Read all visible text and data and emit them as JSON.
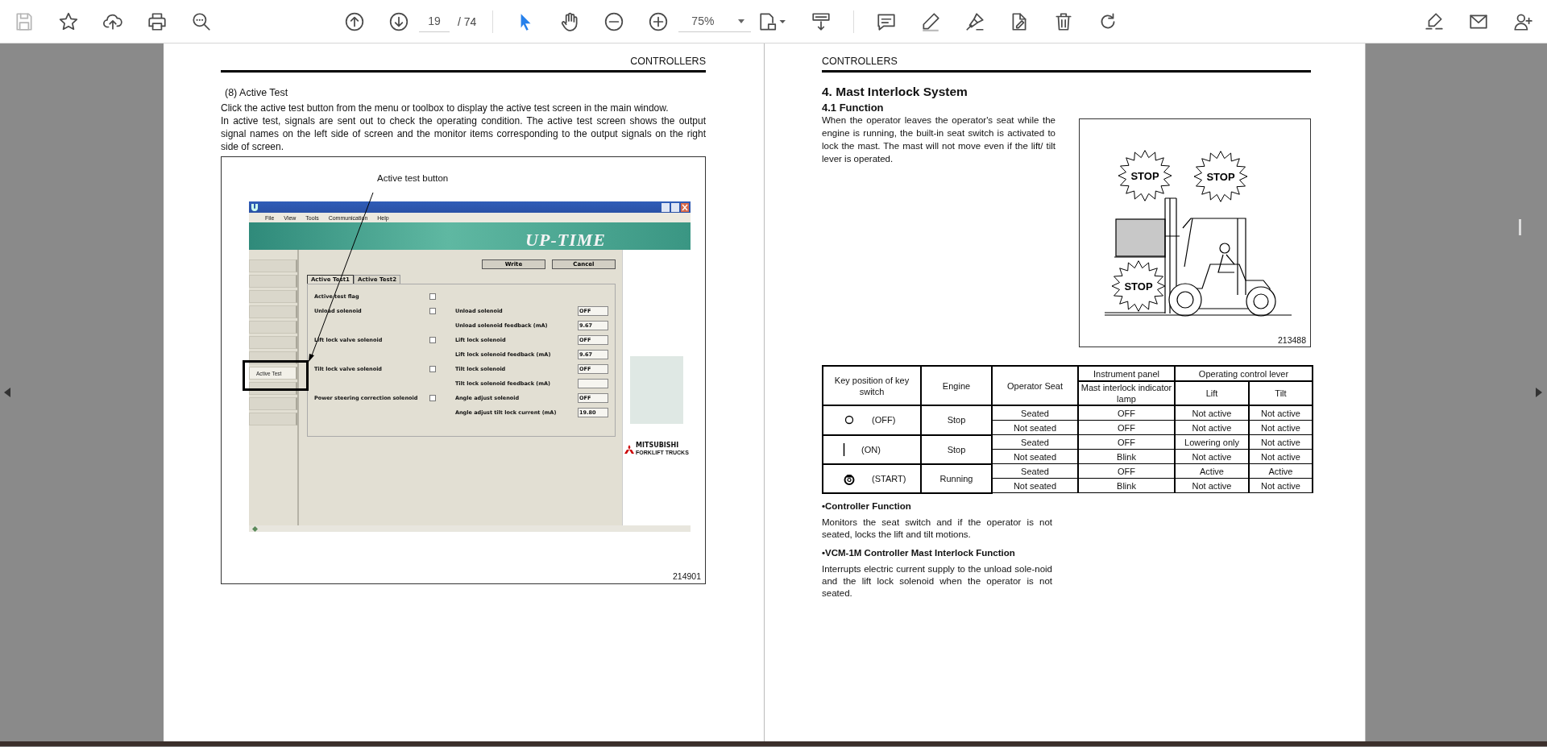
{
  "toolbar": {
    "file_tools": [
      {
        "kind": "save",
        "disabled": true
      },
      {
        "kind": "bookmark",
        "disabled": false
      },
      {
        "kind": "upload",
        "disabled": false
      },
      {
        "kind": "print",
        "disabled": false
      },
      {
        "kind": "find",
        "disabled": false
      }
    ],
    "page_nav": {
      "current": "19",
      "total": "/ 74"
    },
    "modes": [
      {
        "kind": "select",
        "selected": true
      },
      {
        "kind": "hand",
        "selected": false
      }
    ],
    "zoom": {
      "value": "75%"
    },
    "annotate_tools": [
      {
        "kind": "comment"
      },
      {
        "kind": "pencil"
      },
      {
        "kind": "sign"
      },
      {
        "kind": "edit"
      },
      {
        "kind": "trash"
      },
      {
        "kind": "rotate"
      }
    ],
    "right_tools": [
      {
        "kind": "share"
      },
      {
        "kind": "mail"
      },
      {
        "kind": "adduser"
      }
    ]
  },
  "left_page": {
    "header": "CONTROLLERS",
    "section_title": "(8)  Active Test",
    "paragraphs": [
      "Click the active test button from the menu or toolbox to display the active test screen in the main window.",
      "In active test, signals are sent out to check the operating condition. The active test screen shows the output signal names on the left side of screen and the monitor items corresponding to the output signals on the right side of screen."
    ],
    "figure": {
      "callout": "Active test button",
      "figure_number": "214901",
      "app": {
        "menu": [
          "File",
          "View",
          "Tools",
          "Communication",
          "Help"
        ],
        "banner": "UP-TIME",
        "nav_buttons": [
          {
            "kind": "blank",
            "highlighted": false
          },
          {
            "kind": "blank",
            "highlighted": false
          },
          {
            "kind": "blank",
            "highlighted": false
          },
          {
            "kind": "blank",
            "highlighted": false
          },
          {
            "kind": "blank",
            "highlighted": false
          },
          {
            "kind": "blank",
            "highlighted": false
          },
          {
            "kind": "blank",
            "highlighted": false
          },
          {
            "kind": "labeled",
            "label": "Active Test",
            "highlighted": true
          },
          {
            "kind": "blank",
            "highlighted": false
          },
          {
            "kind": "blank",
            "highlighted": false
          },
          {
            "kind": "blank",
            "highlighted": false
          }
        ],
        "buttons": [
          "Write",
          "Cancel"
        ],
        "tabs": [
          {
            "label": "Active Test1",
            "selected": true
          },
          {
            "label": "Active Test2",
            "selected": false
          }
        ],
        "rows": [
          {
            "output": "Active test flag",
            "checked": false
          },
          {
            "output": "Unload solenoid",
            "checked": false,
            "monitor": "Unload solenoid",
            "value": "OFF"
          },
          {
            "monitor": "Unload solenoid feedback (mA)",
            "value": "9.67"
          },
          {
            "output": "Lift lock valve solenoid",
            "checked": false,
            "monitor": "Lift lock solenoid",
            "value": "OFF"
          },
          {
            "monitor": "Lift lock solenoid feedback (mA)",
            "value": "9.67"
          },
          {
            "output": "Tilt lock valve solenoid",
            "checked": false,
            "monitor": "Tilt lock solenoid",
            "value": "OFF"
          },
          {
            "monitor": "Tilt lock solenoid feedback (mA)"
          },
          {
            "output": "Power steering correction solenoid",
            "checked": false,
            "monitor": "Angle adjust solenoid",
            "value": "OFF"
          },
          {
            "monitor": "Angle adjust tilt lock current (mA)",
            "value": "19.80"
          }
        ],
        "logo": [
          "MITSUBISHI",
          "FORKLIFT TRUCKS"
        ]
      }
    }
  },
  "right_page": {
    "header": "CONTROLLERS",
    "title": "4.  Mast Interlock System",
    "subtitle": "4.1  Function",
    "body": "When the operator leaves the operator's seat while the engine is running, the built-in seat switch is activated to lock the mast. The mast will not move even if the lift/ tilt lever is operated.",
    "figure": {
      "stops": [
        "STOP",
        "STOP",
        "STOP"
      ],
      "figure_number": "213488"
    },
    "table": {
      "header": {
        "key": "Key position of key switch",
        "engine": "Engine",
        "seat": "Operator Seat",
        "panel": "Instrument panel",
        "lamp": "Mast interlock indicator lamp",
        "lever": "Operating control lever",
        "lift": "Lift",
        "tilt": "Tilt"
      },
      "rows": [
        {
          "kind": "off",
          "key_label": "(OFF)",
          "engine": "Stop",
          "states": [
            {
              "seat": "Seated",
              "lamp": "OFF",
              "lift": "Not active",
              "tilt": "Not active"
            },
            {
              "seat": "Not seated",
              "lamp": "OFF",
              "lift": "Not active",
              "tilt": "Not active"
            }
          ]
        },
        {
          "kind": "on",
          "key_label": "(ON)",
          "engine": "Stop",
          "states": [
            {
              "seat": "Seated",
              "lamp": "OFF",
              "lift": "Lowering only",
              "tilt": "Not active"
            },
            {
              "seat": "Not seated",
              "lamp": "Blink",
              "lift": "Not active",
              "tilt": "Not active"
            }
          ]
        },
        {
          "kind": "start",
          "key_label": "(START)",
          "engine": "Running",
          "states": [
            {
              "seat": "Seated",
              "lamp": "OFF",
              "lift": "Active",
              "tilt": "Active"
            },
            {
              "seat": "Not seated",
              "lamp": "Blink",
              "lift": "Not active",
              "tilt": "Not active"
            }
          ]
        }
      ]
    },
    "sections": [
      {
        "heading": "•Controller Function",
        "text": "Monitors the seat switch and if the operator is not seated, locks the lift and tilt motions."
      },
      {
        "heading": "•VCM-1M Controller Mast Interlock Function",
        "text": "Interrupts electric current supply to the unload sole-noid and the lift lock solenoid when the operator is not seated."
      }
    ]
  }
}
